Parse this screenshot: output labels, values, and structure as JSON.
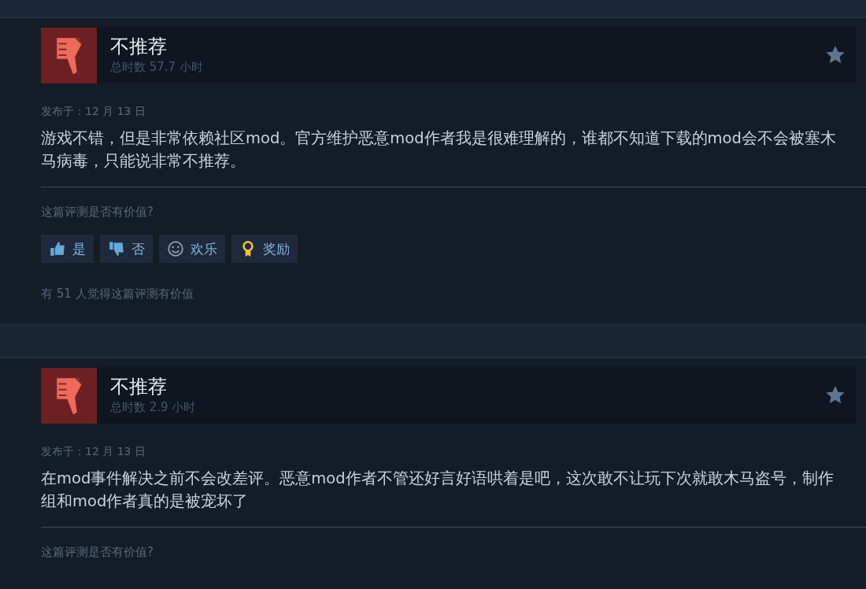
{
  "reviews": [
    {
      "verdict": "不推荐",
      "recommended": false,
      "hours": "总时数 57.7 小时",
      "posted": "发布于：12 月 13 日",
      "text": "游戏不错，但是非常依赖社区mod。官方维护恶意mod作者我是很难理解的，谁都不知道下载的mod会不会被塞木马病毒，只能说非常不推荐。",
      "helpful_prompt": "这篇评测是否有价值?",
      "buttons": [
        {
          "kind": "yes",
          "label": "是"
        },
        {
          "kind": "no",
          "label": "否"
        },
        {
          "kind": "funny",
          "label": "欢乐"
        },
        {
          "kind": "award",
          "label": "奖励"
        }
      ],
      "helpful_count": "有 51 人觉得这篇评测有价值"
    },
    {
      "verdict": "不推荐",
      "recommended": false,
      "hours": "总时数 2.9 小时",
      "posted": "发布于：12 月 13 日",
      "text": "在mod事件解决之前不会改差评。恶意mod作者不管还好言好语哄着是吧，这次敢不让玩下次就敢木马盗号，制作组和mod作者真的是被宠坏了",
      "helpful_prompt": "这篇评测是否有价值?"
    }
  ]
}
